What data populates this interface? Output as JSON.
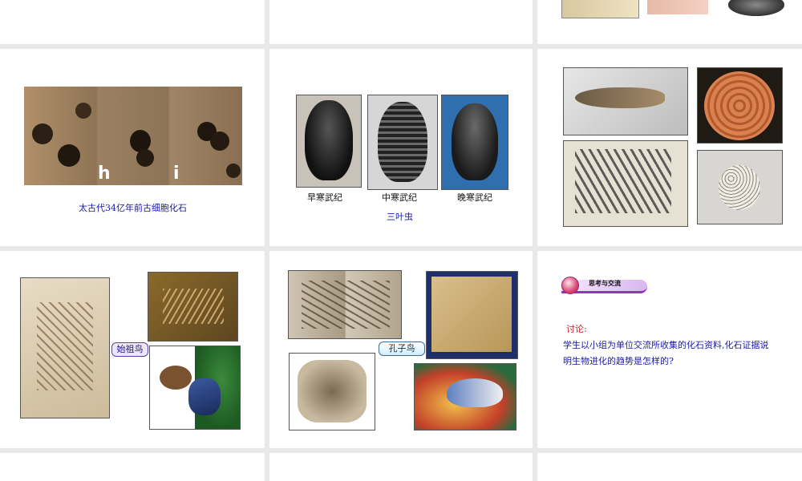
{
  "slides": {
    "archean_cells": {
      "caption": "太古代34亿年前古细胞化石",
      "letter_h": "h",
      "letter_i": "i"
    },
    "trilobite": {
      "early": "早寒武纪",
      "middle": "中寒武纪",
      "late": "晚寒武纪",
      "caption": "三叶虫"
    },
    "archaeopteryx": {
      "tag": "始祖鸟"
    },
    "confuciusornis": {
      "tag": "孔子鸟"
    },
    "discussion": {
      "banner": "思考与交流",
      "heading": "讨论:",
      "text": "学生以小组为单位交流所收集的化石资料,化石证据说明生物进化的趋势是怎样的?"
    }
  },
  "colors": {
    "gap": "#e8e8e8",
    "caption_blue": "#1a1aa8",
    "discussion_red": "#c0262b",
    "banner_purple": "#9a2fc0"
  }
}
